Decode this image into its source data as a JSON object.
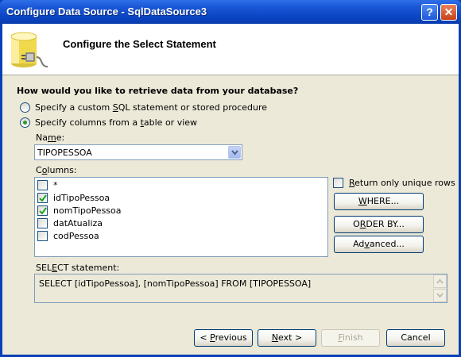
{
  "window": {
    "title": "Configure Data Source - SqlDataSource3",
    "help_label": "?",
    "close_label": "✕"
  },
  "header": {
    "title": "Configure the Select Statement",
    "icon": "database-plug-icon"
  },
  "question": "How would you like to retrieve data from your database?",
  "options": {
    "custom": {
      "pre": "Specify a custom ",
      "u": "S",
      "post": "QL statement or stored procedure",
      "selected": false
    },
    "columns": {
      "pre": "Specify columns from a ",
      "u": "t",
      "post": "able or view",
      "selected": true
    }
  },
  "name": {
    "pre": "Na",
    "u": "m",
    "post": "e:",
    "value": "TIPOPESSOA"
  },
  "columns": {
    "pre": "C",
    "u": "o",
    "post": "lumns:",
    "items": [
      {
        "label": "*",
        "checked": false
      },
      {
        "label": "idTipoPessoa",
        "checked": true
      },
      {
        "label": "nomTipoPessoa",
        "checked": true
      },
      {
        "label": "datAtualiza",
        "checked": false
      },
      {
        "label": "codPessoa",
        "checked": false
      }
    ]
  },
  "unique": {
    "u": "R",
    "post": "eturn only unique rows",
    "checked": false
  },
  "buttons": {
    "where": {
      "u": "W",
      "post": "HERE..."
    },
    "order": {
      "pre": "O",
      "u": "R",
      "post": "DER BY..."
    },
    "advanced": {
      "pre": "Ad",
      "u": "v",
      "post": "anced..."
    }
  },
  "statement": {
    "pre": "SEL",
    "u": "E",
    "post": "CT statement:",
    "text": "SELECT [idTipoPessoa], [nomTipoPessoa] FROM [TIPOPESSOA]"
  },
  "footer": {
    "previous": {
      "pre": "< ",
      "u": "P",
      "post": "revious"
    },
    "next": {
      "u": "N",
      "post": "ext >"
    },
    "finish": {
      "u": "F",
      "post": "inish",
      "enabled": false
    },
    "cancel": "Cancel"
  }
}
